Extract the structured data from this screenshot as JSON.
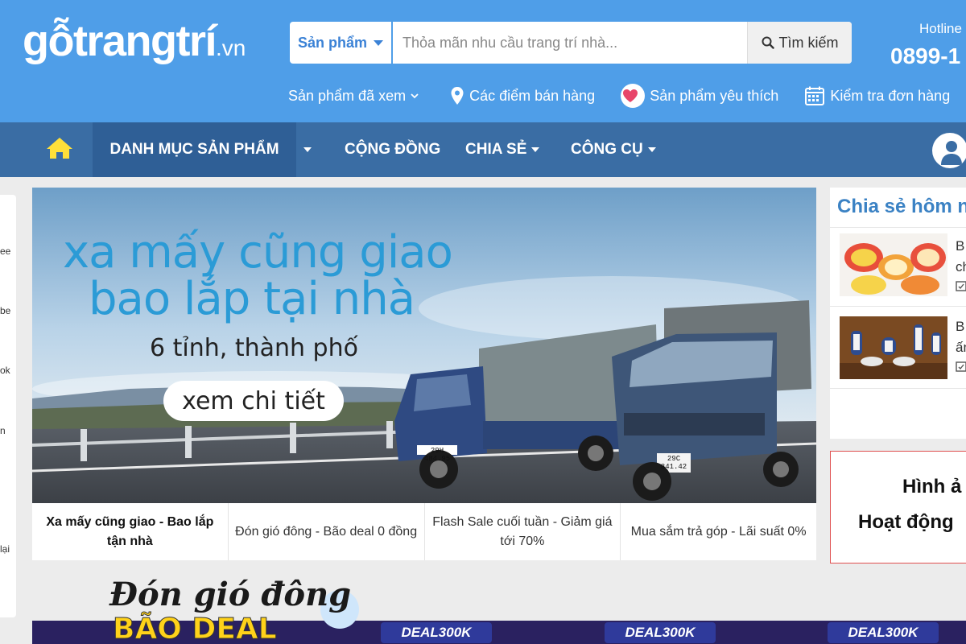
{
  "header": {
    "logo_main": "gỗtrangtrí",
    "logo_tld": ".vn",
    "search": {
      "category": "Sản phẩm",
      "placeholder": "Thỏa mãn nhu cầu trang trí nhà...",
      "button": "Tìm kiếm"
    },
    "hotline_label": "Hotline",
    "hotline_number": "0899-1",
    "sublinks": {
      "viewed": "Sản phẩm đã xem",
      "stores": "Các điểm bán hàng",
      "favorites": "Sản phẩm yêu thích",
      "order_check": "Kiểm tra đơn hàng"
    }
  },
  "nav": {
    "categories": "DANH MỤC SẢN PHẨM",
    "community": "CỘNG ĐỒNG",
    "share": "CHIA SẺ",
    "tools": "CÔNG CỤ"
  },
  "left_panel": {
    "snippets": [
      "ee",
      "be",
      "ok",
      "n",
      "lại"
    ]
  },
  "banner": {
    "headline_1": "xa mấy cũng giao",
    "headline_2": "bao lắp tại nhà",
    "subline": "6 tỉnh, thành phố",
    "cta": "xem chi tiết",
    "truck_plate_1": "29H 484.95",
    "truck_plate_2": "29C 841.42",
    "captions": [
      "Xa mấy cũng giao - Bao lắp tận nhà",
      "Đón gió đông - Bão deal 0 đồng",
      "Flash Sale cuối tuần - Giảm giá tới 70%",
      "Mua sắm trả góp - Lãi suất 0%"
    ]
  },
  "sidebar": {
    "share_title": "Chia sẻ hôm n",
    "items": [
      {
        "line1": "B",
        "line2": "ch"
      },
      {
        "line1": "B",
        "line2": "ấn"
      }
    ],
    "photo_title_1": "Hình ả",
    "photo_title_2": "Hoạt động"
  },
  "promo": {
    "script": "Đón gió đông",
    "headline": "BÃO DEAL",
    "badges": [
      "DEAL300K",
      "DEAL300K",
      "DEAL300K"
    ]
  },
  "colors": {
    "header_bg": "#4f9ee8",
    "nav_bg": "#3a6da4",
    "nav_active": "#2f5f96",
    "accent_blue": "#2b9bd6",
    "home_icon": "#ffe03a",
    "heart": "#e8456a"
  },
  "icons": [
    "search-icon",
    "location-pin-icon",
    "heart-icon",
    "calendar-icon",
    "home-icon",
    "user-icon",
    "chevron-down-icon"
  ]
}
